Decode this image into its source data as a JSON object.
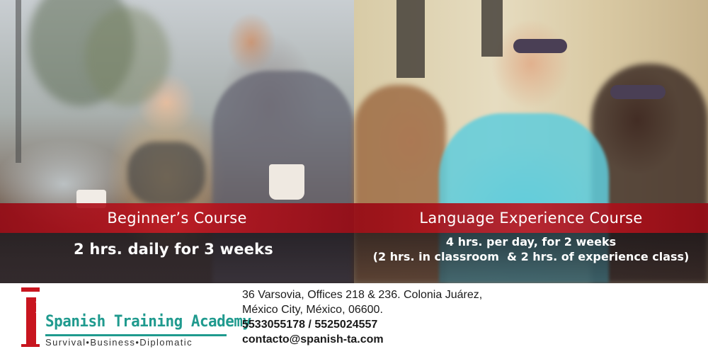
{
  "courses": {
    "beginner": {
      "title": "Beginner’s Course",
      "schedule": "2 hrs. daily for 3 weeks"
    },
    "experience": {
      "title": "Language Experience Course",
      "schedule": "4 hrs. per day, for 2 weeks",
      "breakdown": "(2 hrs. in classroom  & 2 hrs. of experience class)"
    }
  },
  "brand": {
    "name": "Spanish Training Academy",
    "tagline": "Survival•Business•Diplomatic",
    "accent_color": "#1f9a8e",
    "mark_color": "#c8151f"
  },
  "contact": {
    "address_line1": "36 Varsovia, Offices 218 & 236. Colonia Juárez,",
    "address_line2": "México City, México, 06600.",
    "phones": "5533055178 / 5525024557",
    "email": "contacto@spanish-ta.com"
  },
  "colors": {
    "band_red": "#b0141e",
    "text_white": "#ffffff"
  }
}
